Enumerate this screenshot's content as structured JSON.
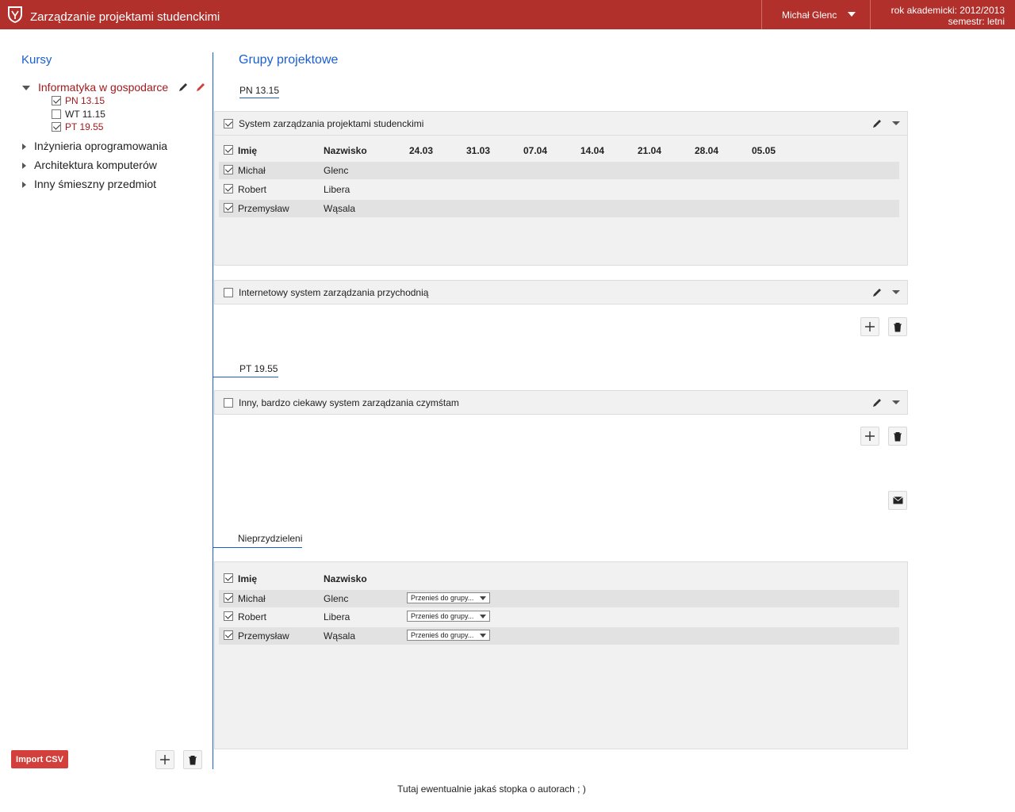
{
  "header": {
    "title": "Zarządzanie projektami studenckimi",
    "user": "Michał Glenc",
    "year": "rok akademicki: 2012/2013",
    "semester": "semestr: letni"
  },
  "sidebar": {
    "title": "Kursy",
    "courses": [
      {
        "label": "Informatyka w gospodarce",
        "expanded": true,
        "groups": [
          {
            "label": "PN 13.15",
            "checked": true
          },
          {
            "label": "WT 11.15",
            "checked": false
          },
          {
            "label": "PT 19.55",
            "checked": true
          }
        ]
      },
      {
        "label": "Inżynieria oprogramowania",
        "expanded": false
      },
      {
        "label": "Architektura komputerów",
        "expanded": false
      },
      {
        "label": "Inny śmieszny przedmiot",
        "expanded": false
      }
    ],
    "import_label": "Import CSV"
  },
  "main": {
    "title": "Grupy projektowe",
    "sections": [
      {
        "label": "PN 13.15",
        "groups": [
          {
            "name": "System zarządzania projektami studenckimi",
            "checked": true,
            "columns": [
              "Imię",
              "Nazwisko"
            ],
            "dates": [
              "24.03",
              "31.03",
              "07.04",
              "14.04",
              "21.04",
              "28.04",
              "05.05"
            ],
            "students": [
              {
                "first": "Michał",
                "last": "Glenc"
              },
              {
                "first": "Robert",
                "last": "Libera"
              },
              {
                "first": "Przemysław",
                "last": "Wąsala"
              }
            ]
          },
          {
            "name": "Internetowy system zarządzania przychodnią",
            "checked": false
          }
        ]
      },
      {
        "label": "PT 19.55",
        "groups": [
          {
            "name": "Inny, bardzo ciekawy system zarządzania czymśtam",
            "checked": false
          }
        ]
      }
    ],
    "unassigned": {
      "label": "Nieprzydzieleni",
      "columns": [
        "Imię",
        "Nazwisko"
      ],
      "select_placeholder": "Przenieś do grupy...",
      "students": [
        {
          "first": "Michał",
          "last": "Glenc"
        },
        {
          "first": "Robert",
          "last": "Libera"
        },
        {
          "first": "Przemysław",
          "last": "Wąsala"
        }
      ]
    }
  },
  "footer": "Tutaj ewentualnie jakaś stopka o autorach ; )",
  "colors": {
    "brand": "#b1302b",
    "accent": "#1a5fd0",
    "active": "#a3191b"
  }
}
